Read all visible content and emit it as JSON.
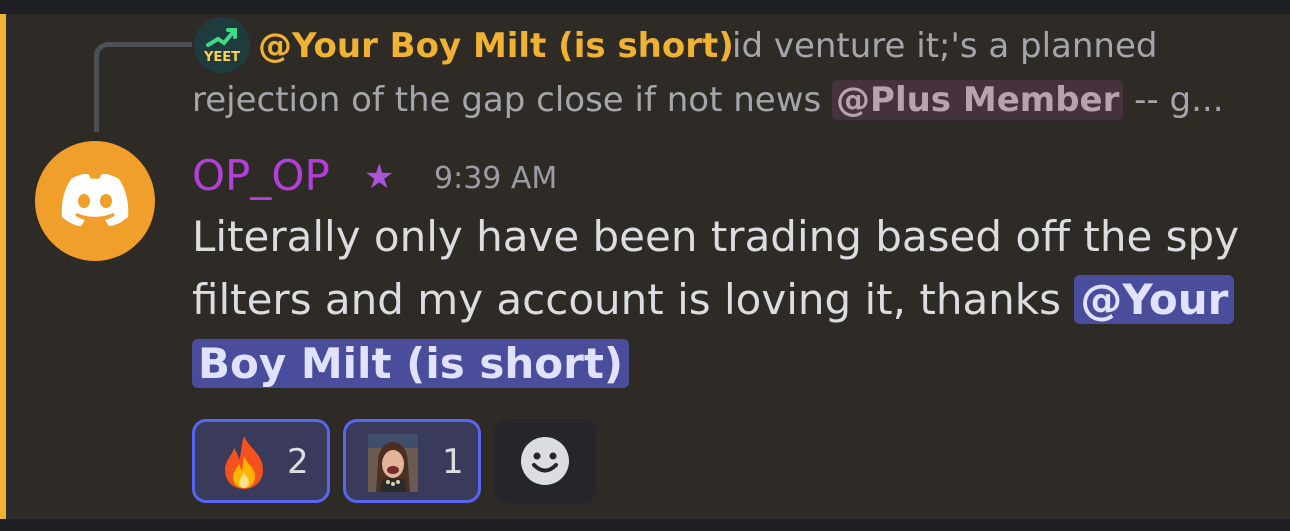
{
  "reply": {
    "avatar_text": "YEET",
    "author": "@Your Boy Milt (is short)",
    "line1": "id venture it;'s a planned",
    "line2_before": "rejection of the gap close if not news ",
    "role_mention": "@Plus Member",
    "line2_after": " -- g..."
  },
  "message": {
    "author": "OP_OP",
    "timestamp": "9:39 AM",
    "line1": "Literally only have been trading based off the spy",
    "line2_before": "filters and my account is loving it, thanks ",
    "mention_part1": "@Your",
    "mention_part2": "Boy Milt (is short)"
  },
  "reactions": [
    {
      "emoji_name": "fire-emoji",
      "count": "2"
    },
    {
      "emoji_name": "laughing-person-emoji",
      "count": "1"
    }
  ],
  "add_reaction": {
    "icon": "smiley-icon"
  },
  "colors": {
    "accent_bar": "#f0b232",
    "reply_author": "#f0b232",
    "author": "#b23fd8",
    "mention_bg": "#4a4d9c",
    "reaction_border": "#5865f2"
  }
}
